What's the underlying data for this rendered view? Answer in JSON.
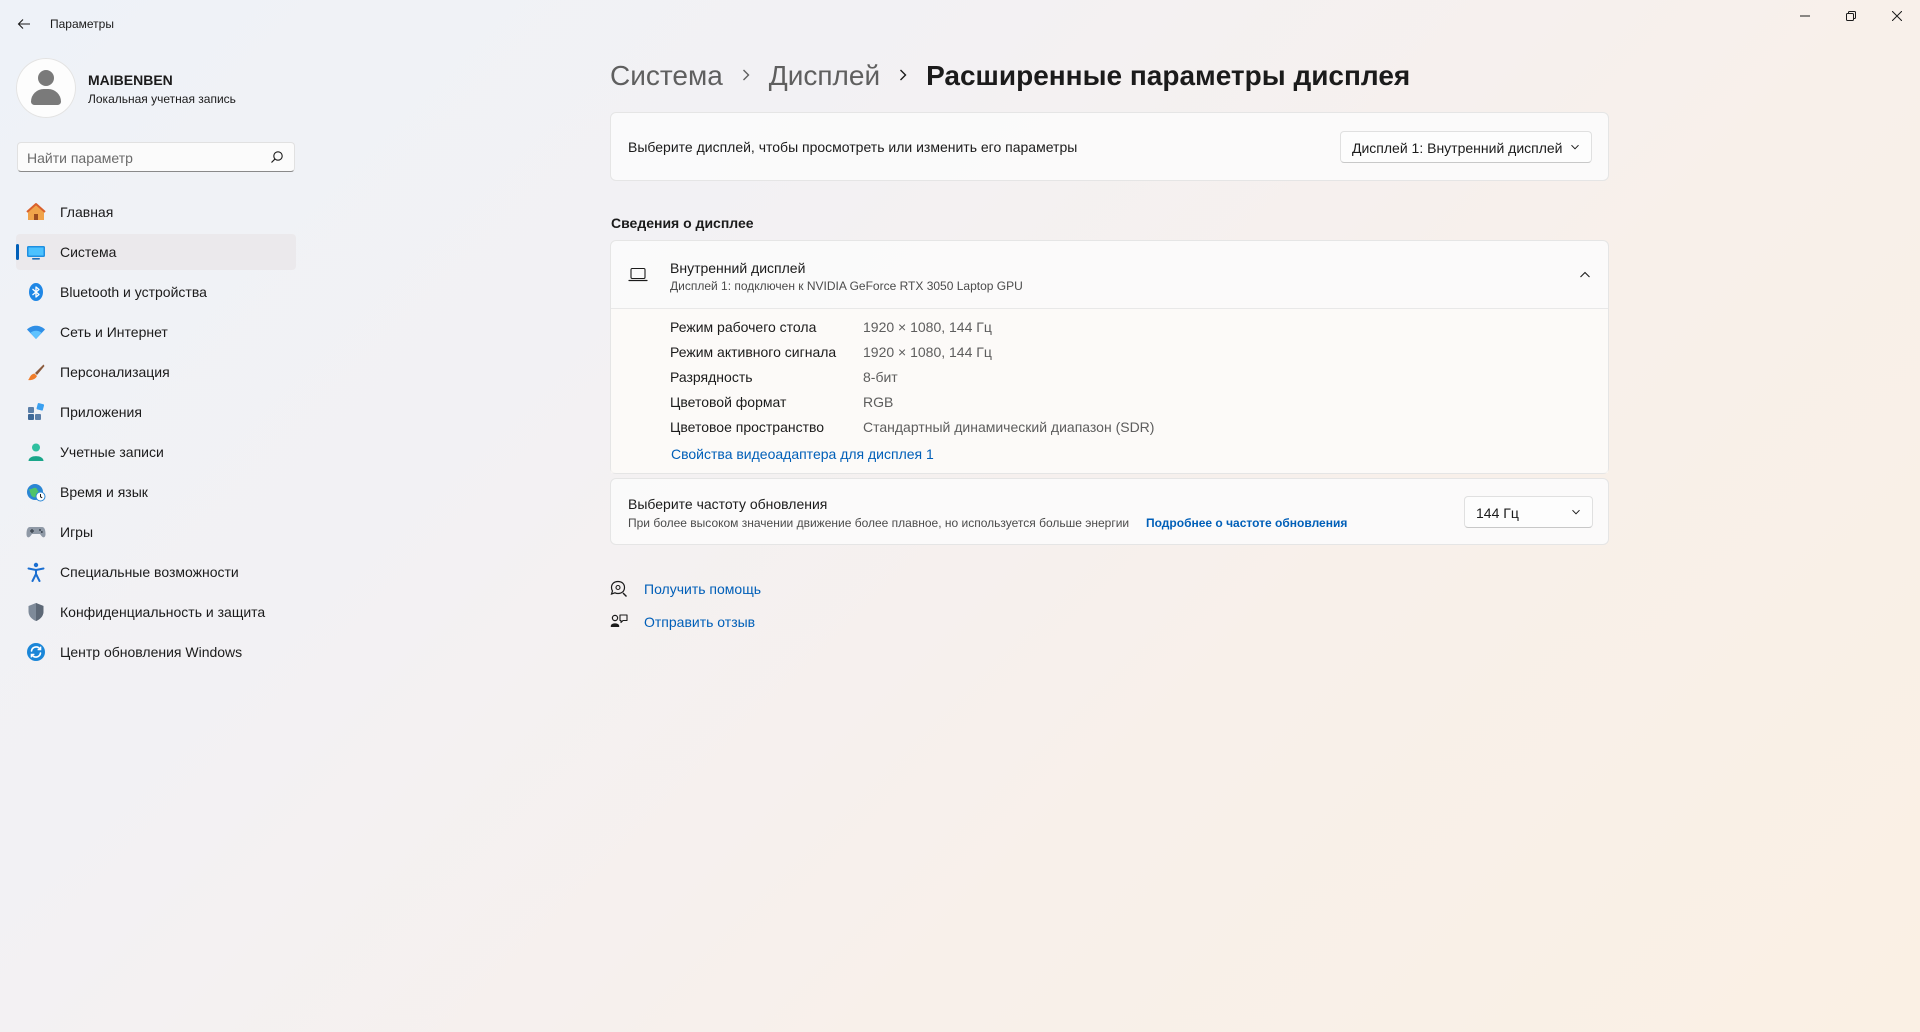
{
  "window": {
    "title": "Параметры"
  },
  "profile": {
    "name": "MAIBENBEN",
    "account_type": "Локальная учетная запись"
  },
  "search": {
    "placeholder": "Найти параметр"
  },
  "sidebar": {
    "items": [
      {
        "label": "Главная",
        "icon": "home-icon",
        "active": false
      },
      {
        "label": "Система",
        "icon": "system-icon",
        "active": true
      },
      {
        "label": "Bluetooth и устройства",
        "icon": "bluetooth-icon",
        "active": false
      },
      {
        "label": "Сеть и Интернет",
        "icon": "wifi-icon",
        "active": false
      },
      {
        "label": "Персонализация",
        "icon": "brush-icon",
        "active": false
      },
      {
        "label": "Приложения",
        "icon": "apps-icon",
        "active": false
      },
      {
        "label": "Учетные записи",
        "icon": "accounts-icon",
        "active": false
      },
      {
        "label": "Время и язык",
        "icon": "time-language-icon",
        "active": false
      },
      {
        "label": "Игры",
        "icon": "gamepad-icon",
        "active": false
      },
      {
        "label": "Специальные возможности",
        "icon": "accessibility-icon",
        "active": false
      },
      {
        "label": "Конфиденциальность и защита",
        "icon": "shield-icon",
        "active": false
      },
      {
        "label": "Центр обновления Windows",
        "icon": "update-icon",
        "active": false
      }
    ]
  },
  "breadcrumb": {
    "items": [
      "Система",
      "Дисплей"
    ],
    "current": "Расширенные параметры дисплея"
  },
  "display_select": {
    "label": "Выберите дисплей, чтобы просмотреть или изменить его параметры",
    "value": "Дисплей 1: Внутренний дисплей"
  },
  "display_info": {
    "section_title": "Сведения о дисплее",
    "title": "Внутренний дисплей",
    "subtitle": "Дисплей 1: подключен к NVIDIA GeForce RTX 3050 Laptop GPU",
    "expanded": true,
    "rows": [
      {
        "key": "Режим рабочего стола",
        "value": "1920 × 1080, 144 Гц"
      },
      {
        "key": "Режим активного сигнала",
        "value": "1920 × 1080, 144 Гц"
      },
      {
        "key": "Разрядность",
        "value": "8-бит"
      },
      {
        "key": "Цветовой формат",
        "value": "RGB"
      },
      {
        "key": "Цветовое пространство",
        "value": "Стандартный динамический диапазон (SDR)"
      }
    ],
    "adapter_link": "Свойства видеоадаптера для дисплея 1"
  },
  "refresh_rate": {
    "title": "Выберите частоту обновления",
    "description": "При более высоком значении движение более плавное, но используется больше энергии",
    "link": "Подробнее о частоте обновления",
    "value": "144 Гц"
  },
  "help": {
    "get_help": "Получить помощь",
    "feedback": "Отправить отзыв"
  },
  "colors": {
    "accent": "#005fb8",
    "active_nav_bg": "#ebe9ec"
  }
}
